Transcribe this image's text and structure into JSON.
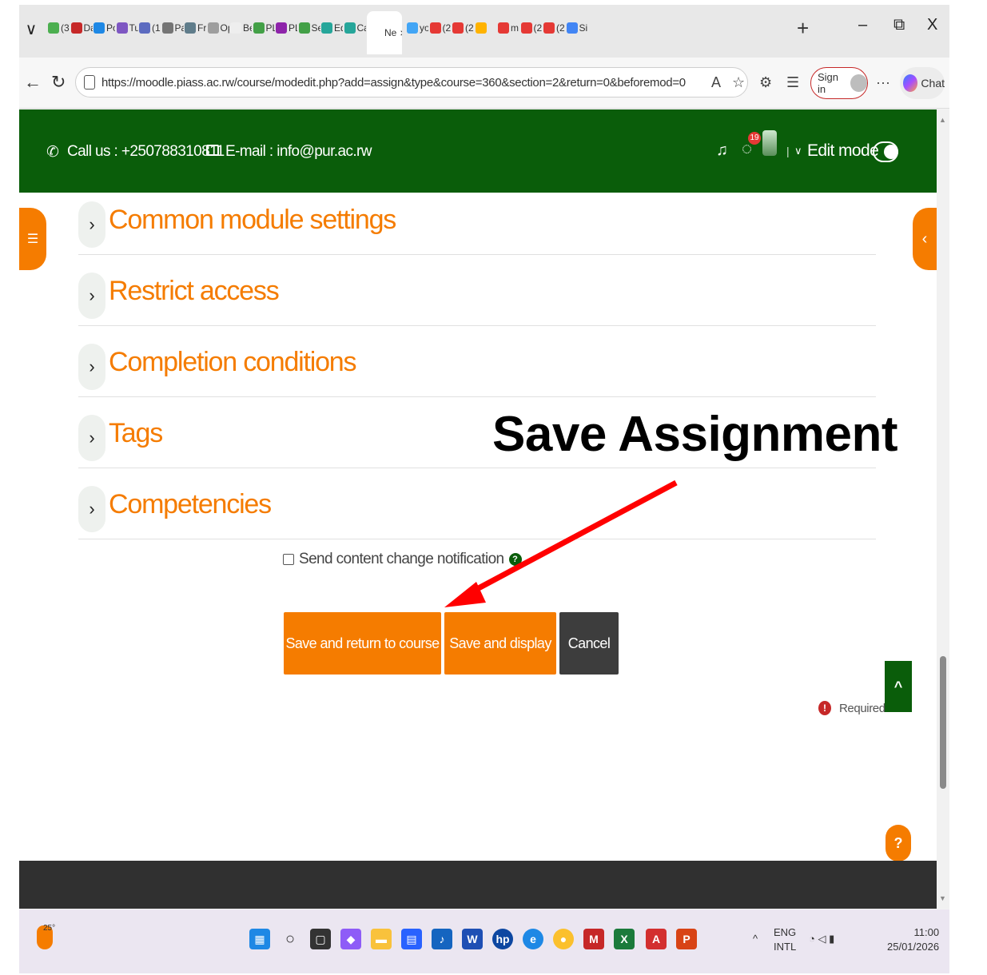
{
  "browser": {
    "tabs": [
      "(3)",
      "Da",
      "Po",
      "Tu",
      "(1",
      "Pa",
      "Fre",
      "Op",
      "Be",
      "PL",
      "PL",
      "Se",
      "Ed",
      "Ca",
      "Ne",
      "yo",
      "(2",
      "(2",
      "",
      "m",
      "(2",
      "(2",
      "Si"
    ],
    "active_tab_label": "Ne",
    "url": "https://moodle.piass.ac.rw/course/modedit.php?add=assign&type&course=360&section=2&return=0&beforemod=0",
    "signin_label": "Sign in",
    "chat_label": "Chat",
    "ellipsis": "···"
  },
  "header": {
    "call_label": "Call us : +250788310811",
    "email_label": "E-mail : info@pur.ac.rw",
    "notification_count": "19",
    "edit_mode_label": "Edit mode",
    "edit_mode_on": true
  },
  "sections": [
    {
      "title": "Common module settings"
    },
    {
      "title": "Restrict access"
    },
    {
      "title": "Completion conditions"
    },
    {
      "title": "Tags"
    },
    {
      "title": "Competencies"
    }
  ],
  "form": {
    "notify_label": "Send content change notification",
    "notify_checked": false,
    "save_return_label": "Save and return to course",
    "save_display_label": "Save and display",
    "cancel_label": "Cancel",
    "required_label": "Required"
  },
  "annotation": {
    "text": "Save Assignment",
    "arrow_color": "#ff0000"
  },
  "taskbar": {
    "temperature": "25°",
    "lang_1": "ENG",
    "lang_2": "INTL",
    "time": "11:00",
    "date": "25/01/2026"
  },
  "colors": {
    "brand_green": "#0a5d0a",
    "accent_orange": "#f57c00",
    "cancel_dark": "#3d3d3d"
  }
}
